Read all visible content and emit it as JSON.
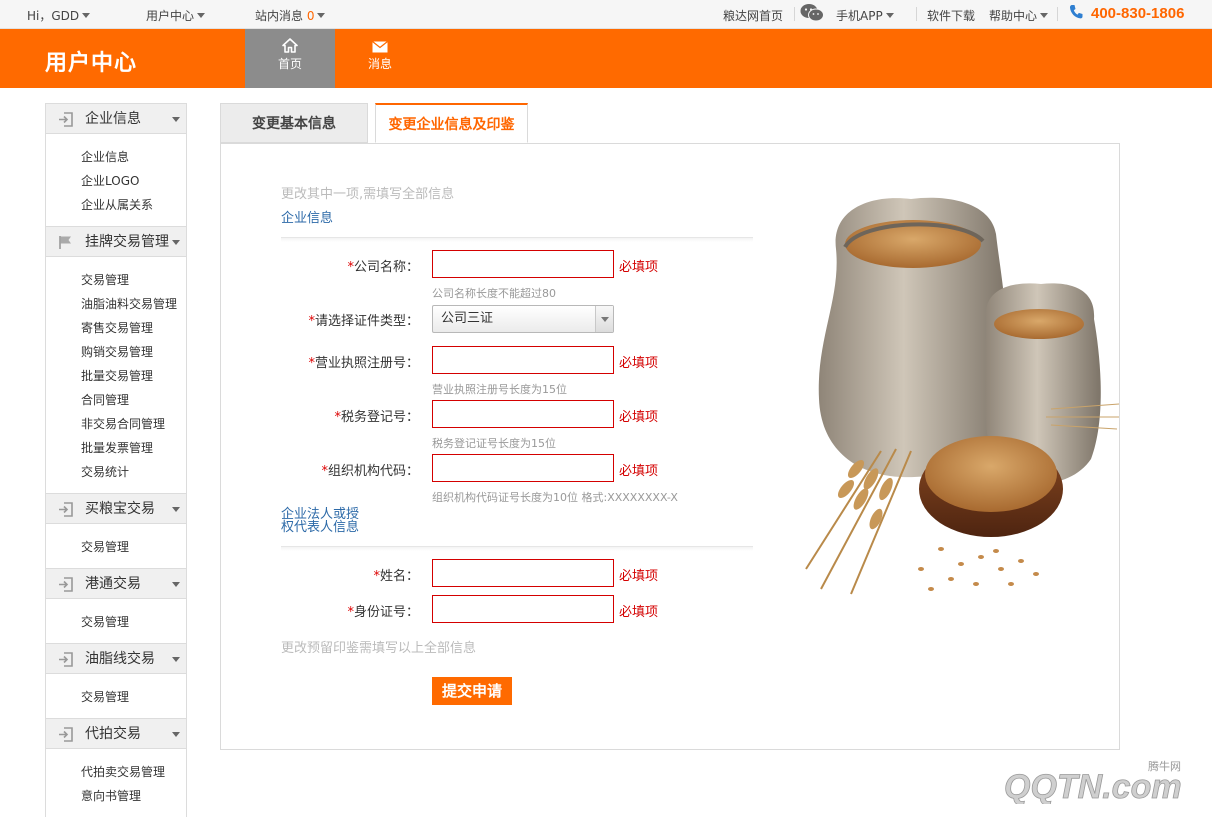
{
  "topbar": {
    "greeting": "Hi，GDD",
    "user_center": "用户中心",
    "site_messages": "站内消息",
    "message_count": "0",
    "home_link": "粮达网首页",
    "mobile_app": "手机APP",
    "software_download": "软件下载",
    "help_center": "帮助中心",
    "phone": "400-830-1806"
  },
  "header": {
    "brand": "用户中心",
    "nav": [
      {
        "label": "首页",
        "icon": "home-icon",
        "active": true
      },
      {
        "label": "消息",
        "icon": "envelope-icon",
        "active": false
      }
    ]
  },
  "sidebar": {
    "sections": [
      {
        "title": "企业信息",
        "icon": "login-arrow-icon",
        "items": [
          "企业信息",
          "企业LOGO",
          "企业从属关系"
        ]
      },
      {
        "title": "挂牌交易管理",
        "icon": "flag-icon",
        "items": [
          "交易管理",
          "油脂油料交易管理",
          "寄售交易管理",
          "购销交易管理",
          "批量交易管理",
          "合同管理",
          "非交易合同管理",
          "批量发票管理",
          "交易统计"
        ]
      },
      {
        "title": "买粮宝交易",
        "icon": "login-arrow-icon",
        "items": [
          "交易管理"
        ]
      },
      {
        "title": "港通交易",
        "icon": "login-arrow-icon",
        "items": [
          "交易管理"
        ]
      },
      {
        "title": "油脂线交易",
        "icon": "login-arrow-icon",
        "items": [
          "交易管理"
        ]
      },
      {
        "title": "代拍交易",
        "icon": "login-arrow-icon",
        "items": [
          "代拍卖交易管理",
          "意向书管理"
        ]
      }
    ]
  },
  "tabs": {
    "basic": "变更基本信息",
    "seal": "变更企业信息及印鉴"
  },
  "form": {
    "hint_top": "更改其中一项,需填写全部信息",
    "section_company": "企业信息",
    "company_name": {
      "label": "公司名称：",
      "value": "",
      "required_text": "必填项",
      "note": "公司名称长度不能超过80"
    },
    "cert_type": {
      "label": "请选择证件类型：",
      "selected": "公司三证"
    },
    "license_no": {
      "label": "营业执照注册号：",
      "value": "",
      "required_text": "必填项",
      "note": "营业执照注册号长度为15位"
    },
    "tax_no": {
      "label": "税务登记号：",
      "value": "",
      "required_text": "必填项",
      "note": "税务登记证号长度为15位"
    },
    "org_code": {
      "label": "组织机构代码：",
      "value": "",
      "required_text": "必填项",
      "note": "组织机构代码证号长度为10位 格式:XXXXXXXX-X"
    },
    "section_legal_line1": "企业法人或授",
    "section_legal_line2": "权代表人信息",
    "name": {
      "label": "姓名：",
      "value": "",
      "required_text": "必填项"
    },
    "id_no": {
      "label": "身份证号：",
      "value": "",
      "required_text": "必填项"
    },
    "hint_bottom": "更改预留印鉴需填写以上全部信息",
    "submit": "提交申请",
    "required_mark": "*"
  },
  "image": {
    "subject": "burlap sacks of wheat grains with wheat ears"
  },
  "watermark": {
    "text": "QQTN.com",
    "brand_small": "腾牛网"
  },
  "colors": {
    "accent": "#ff6a00",
    "required": "#d40000",
    "link": "#2d6aa8"
  }
}
